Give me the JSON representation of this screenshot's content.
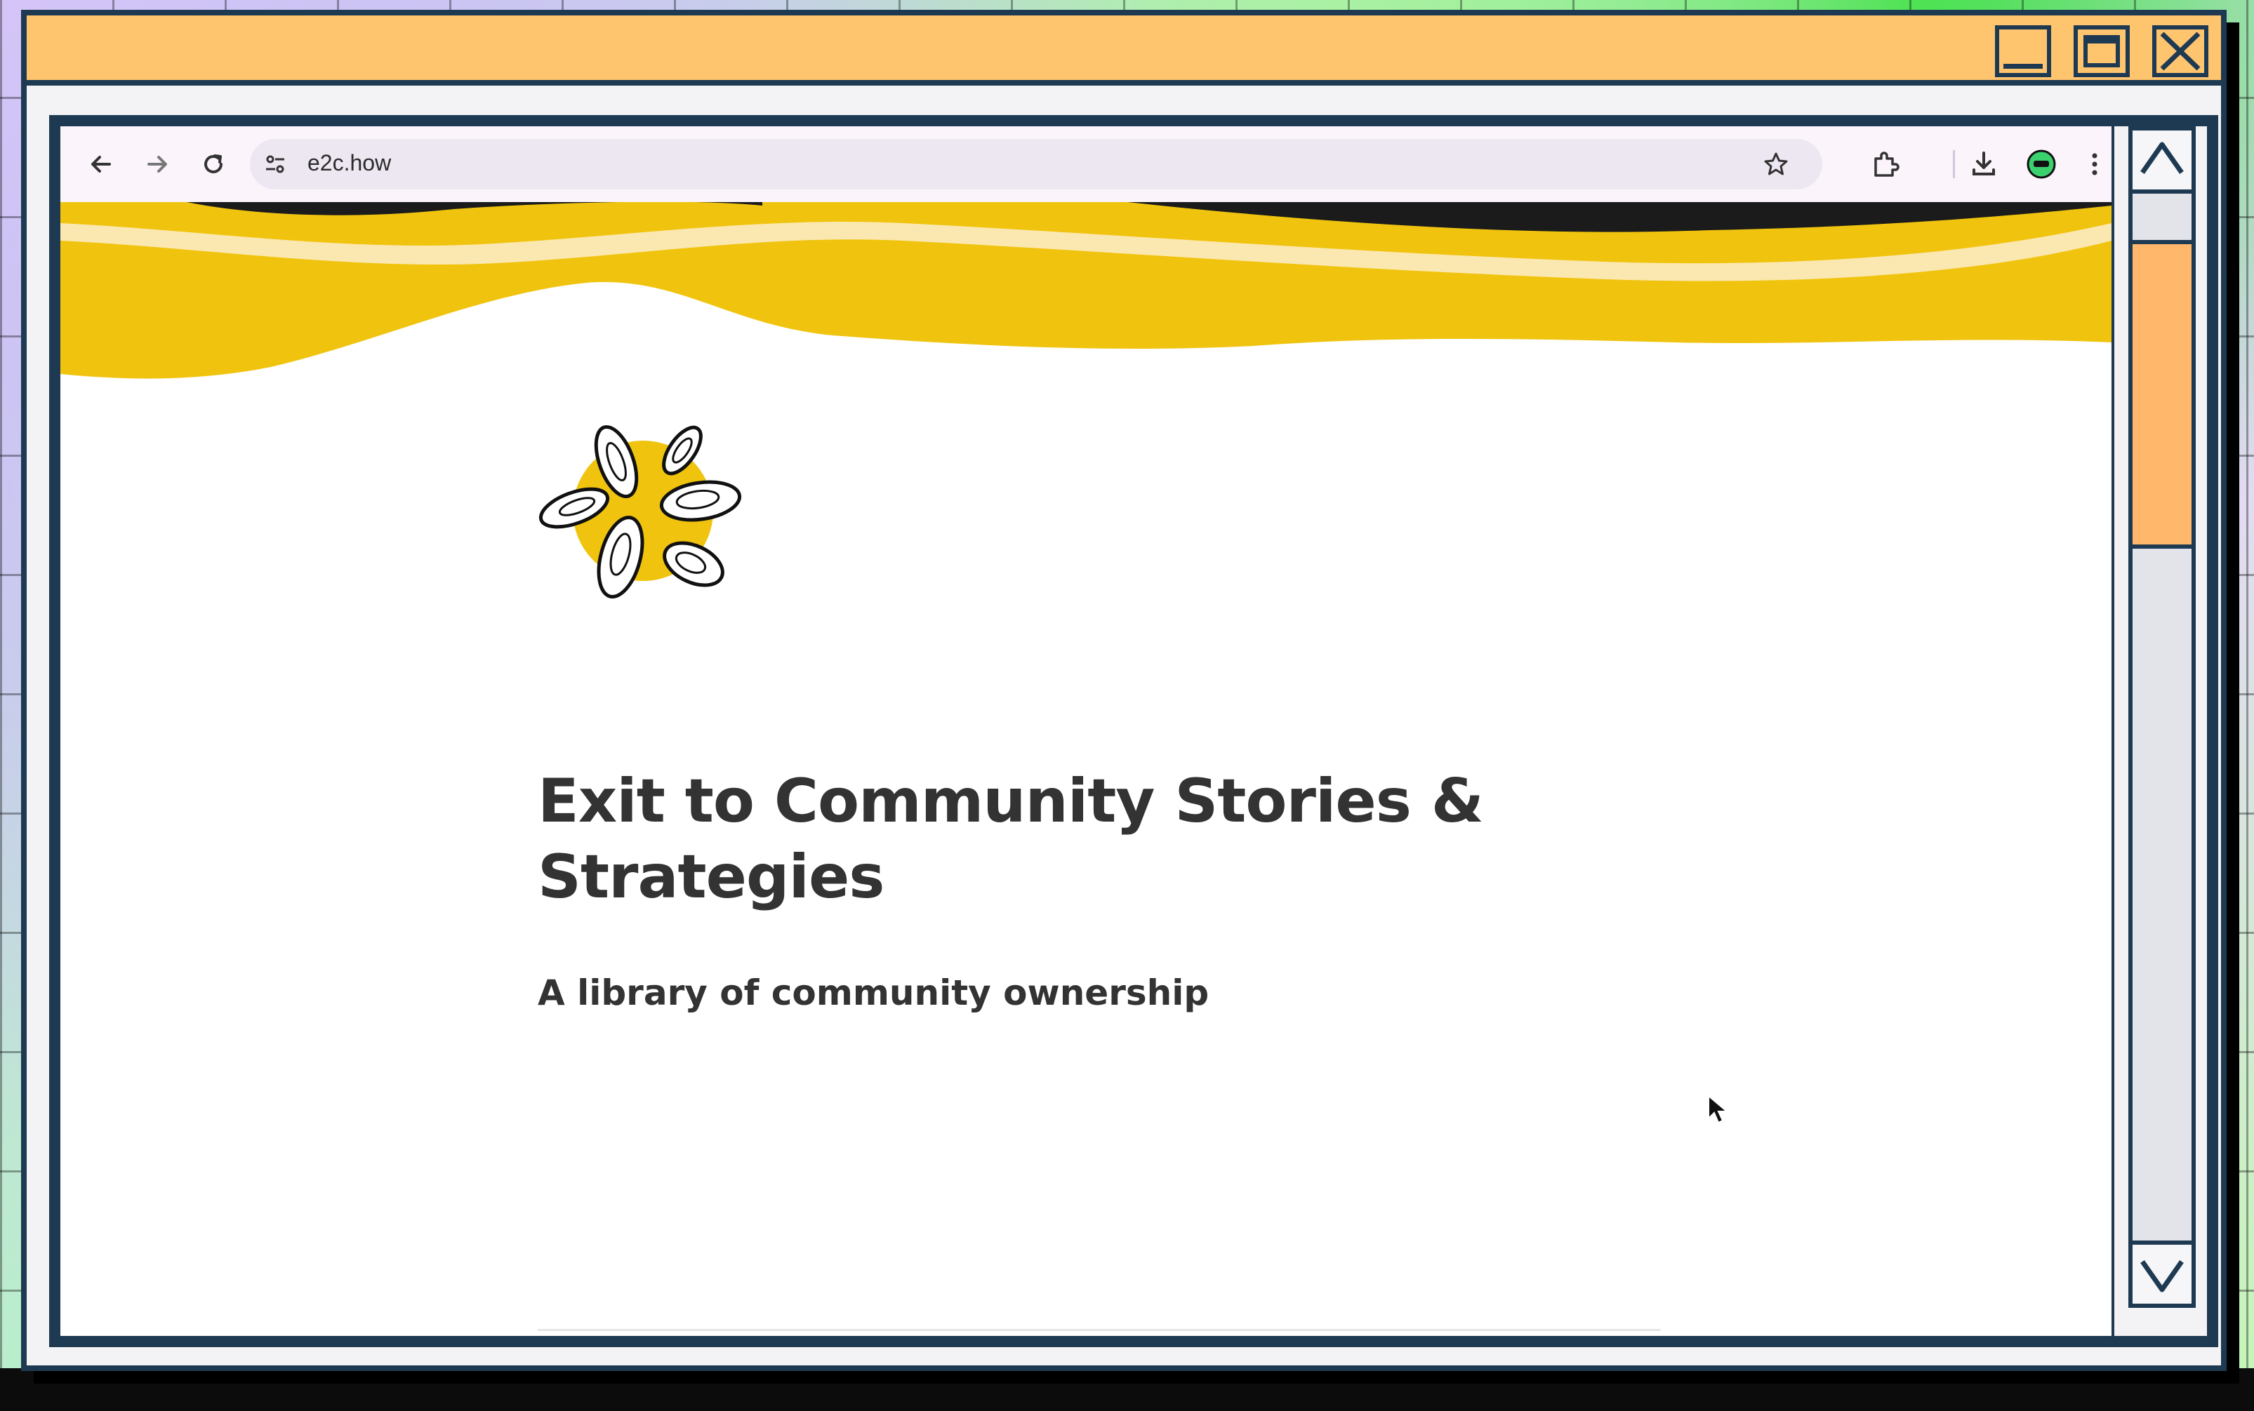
{
  "window": {
    "minimize_icon": "minimize-icon",
    "maximize_icon": "maximize-icon",
    "close_icon": "close-icon",
    "titlebar_color": "#ffc46e",
    "frame_color": "#1e3a52"
  },
  "browser": {
    "url": "e2c.how",
    "icons": [
      "back-arrow-icon",
      "forward-arrow-icon",
      "reload-icon",
      "site-settings-icon",
      "star-icon",
      "extensions-icon",
      "download-icon",
      "extension-badge-icon",
      "more-menu-icon"
    ]
  },
  "page": {
    "title": "Exit to Community Stories & Strategies",
    "subtitle": "A library of community ownership",
    "accent_color": "#f0c40e",
    "logo_icon": "oyster-flower-logo"
  },
  "scrollbar": {
    "up_icon": "scroll-up-icon",
    "down_icon": "scroll-down-icon",
    "thumb_color": "#ffb86b"
  }
}
